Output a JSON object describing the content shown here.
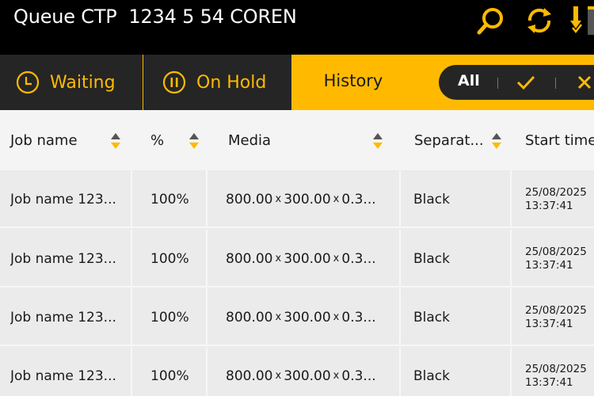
{
  "header": {
    "title": "Queue CTP  1234 5 54 COREN",
    "icons": [
      "search-icon",
      "sync-icon",
      "export-icon"
    ]
  },
  "tabs": [
    {
      "label": "Waiting",
      "icon": "clock-icon"
    },
    {
      "label": "On Hold",
      "icon": "pause-icon"
    },
    {
      "label": "History",
      "active": true
    }
  ],
  "filter": {
    "all_label": "All",
    "icons": [
      "check-icon",
      "close-icon"
    ]
  },
  "table": {
    "columns": [
      "Job name",
      "%",
      "Media",
      "Separat...",
      "Start time"
    ],
    "rows": [
      {
        "job": "Job name 123...",
        "percent": "100%",
        "media_w": "800.00",
        "media_h": "300.00",
        "media_t": "0.3...",
        "sep": "Black",
        "date": "25/08/2025",
        "time": "13:37:41"
      },
      {
        "job": "Job name 123...",
        "percent": "100%",
        "media_w": "800.00",
        "media_h": "300.00",
        "media_t": "0.3...",
        "sep": "Black",
        "date": "25/08/2025",
        "time": "13:37:41"
      },
      {
        "job": "Job name 123...",
        "percent": "100%",
        "media_w": "800.00",
        "media_h": "300.00",
        "media_t": "0.3...",
        "sep": "Black",
        "date": "25/08/2025",
        "time": "13:37:41"
      },
      {
        "job": "Job name 123...",
        "percent": "100%",
        "media_w": "800.00",
        "media_h": "300.00",
        "media_t": "0.3...",
        "sep": "Black",
        "date": "25/08/2025",
        "time": "13:37:41"
      }
    ],
    "media_separator": "x"
  },
  "colors": {
    "accent": "#ffba00",
    "header_bg": "#000000",
    "tab_dark": "#252525",
    "row_bg": "#ebebeb",
    "header_row_bg": "#f4f4f4"
  }
}
